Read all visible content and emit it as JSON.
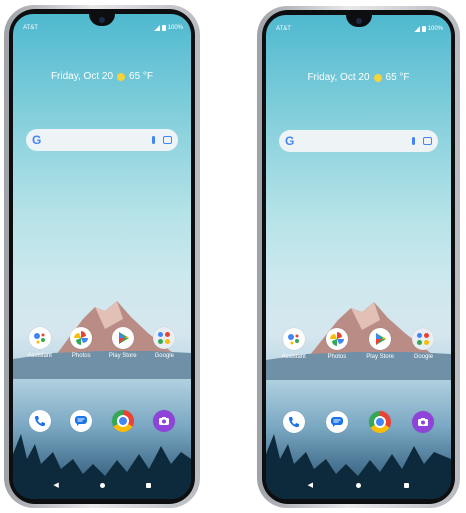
{
  "phones": [
    {
      "status": {
        "carrier": "AT&T",
        "battery": "100%"
      },
      "widget": {
        "date": "Friday, Oct 20",
        "temperature": "65 °F"
      },
      "search": {
        "logo": "G"
      },
      "apps_row1": [
        {
          "label": "Assistant",
          "icon": "assistant-icon"
        },
        {
          "label": "Photos",
          "icon": "photos-icon"
        },
        {
          "label": "Play Store",
          "icon": "play-store-icon"
        },
        {
          "label": "Google",
          "icon": "google-folder-icon"
        }
      ],
      "dock": [
        "phone-icon",
        "messages-icon",
        "chrome-icon",
        "camera-icon"
      ],
      "nav": {
        "back": "◀"
      }
    },
    {
      "status": {
        "carrier": "AT&T",
        "battery": "100%"
      },
      "widget": {
        "date": "Friday, Oct 20",
        "temperature": "65 °F"
      },
      "search": {
        "logo": "G"
      },
      "apps_row1": [
        {
          "label": "Assistant",
          "icon": "assistant-icon"
        },
        {
          "label": "Photos",
          "icon": "photos-icon"
        },
        {
          "label": "Play Store",
          "icon": "play-store-icon"
        },
        {
          "label": "Google",
          "icon": "google-folder-icon"
        }
      ],
      "dock": [
        "phone-icon",
        "messages-icon",
        "chrome-icon",
        "camera-icon"
      ],
      "nav": {
        "back": "◀"
      }
    }
  ],
  "colors": {
    "accent_blue": "#4285f4",
    "sun": "#f5d33a"
  }
}
